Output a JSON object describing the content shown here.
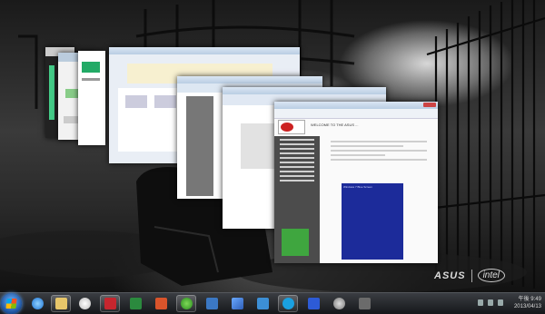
{
  "page_window": {
    "header": "WELCOME TO THE ASUS ...",
    "blue_article_title": "Windows 7 Blue Screen"
  },
  "brand": {
    "oem": "ASUS",
    "chip": "intel"
  },
  "taskbar": {
    "apps": [
      {
        "icon": "start-orb-icon"
      },
      {
        "icon": "internet-explorer-icon"
      },
      {
        "icon": "file-explorer-icon"
      },
      {
        "icon": "itunes-icon"
      },
      {
        "icon": "red-app-icon"
      },
      {
        "icon": "excel-icon"
      },
      {
        "icon": "powerpoint-icon"
      },
      {
        "icon": "utorrent-icon"
      },
      {
        "icon": "task-manager-icon"
      },
      {
        "icon": "window-switcher-icon"
      },
      {
        "icon": "windows-store-icon"
      },
      {
        "icon": "skype-icon"
      },
      {
        "icon": "d-app-icon"
      },
      {
        "icon": "misc-app-icon"
      }
    ],
    "clock": {
      "time": "午後 9:49",
      "date": "2013/04/13"
    }
  },
  "colors": {
    "taskbar": "#1a1c20",
    "blue_screen": "#1c2b9a",
    "sidebar_gray": "#4c4c4c",
    "ie_blue": "#1e73d2"
  }
}
